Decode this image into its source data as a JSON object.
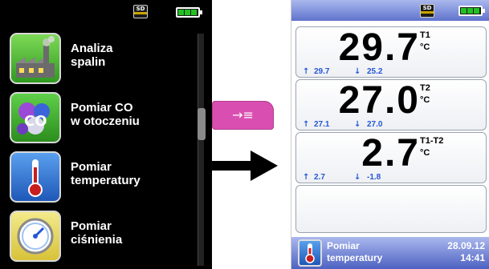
{
  "status": {
    "sd_label": "SD",
    "battery_icon": "battery-full-icon"
  },
  "menu": {
    "items": [
      {
        "label": "Analiza\nspalin",
        "icon": "factory-exhaust-icon"
      },
      {
        "label": "Pomiar CO\nw otoczeniu",
        "icon": "co-molecule-icon"
      },
      {
        "label": "Pomiar\ntemperatury",
        "icon": "thermometer-icon"
      },
      {
        "label": "Pomiar\nciśnienia",
        "icon": "pressure-gauge-icon"
      }
    ]
  },
  "nav_button": {
    "label": "→≡",
    "icon": "enter-arrow-icon"
  },
  "measurements": [
    {
      "value": "29.7",
      "name": "T1",
      "unit": "°C",
      "max": "29.7",
      "min": "25.2"
    },
    {
      "value": "27.0",
      "name": "T2",
      "unit": "°C",
      "max": "27.1",
      "min": "27.0"
    },
    {
      "value": "2.7",
      "name": "T1-T2",
      "unit": "°C",
      "max": "2.7",
      "min": "-1.8"
    }
  ],
  "footer": {
    "label": "Pomiar\ntemperatury",
    "date": "28.09.12",
    "time": "14:41",
    "icon": "thermometer-icon"
  },
  "colors": {
    "header_blue": "#5f73cc",
    "accent_blue": "#2456d6",
    "nav_button_pink": "#d94fb1"
  }
}
